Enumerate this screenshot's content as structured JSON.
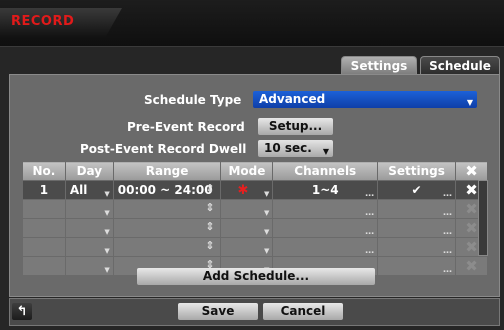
{
  "window": {
    "title": "RECORD"
  },
  "tabs": [
    {
      "label": "Settings"
    },
    {
      "label": "Schedule"
    }
  ],
  "schedule_type": {
    "label": "Schedule Type",
    "value": "Advanced"
  },
  "pre_event": {
    "label": "Pre-Event Record",
    "button": "Setup..."
  },
  "post_event": {
    "label": "Post-Event Record Dwell",
    "value": "10 sec."
  },
  "table": {
    "headers": [
      "No.",
      "Day",
      "Range",
      "Mode",
      "Channels",
      "Settings"
    ],
    "rows": [
      {
        "no": "1",
        "day": "All",
        "range": "00:00 ~ 24:00",
        "channels": "1~4",
        "settings": "✔"
      }
    ]
  },
  "add_schedule": "Add Schedule...",
  "footer": {
    "save": "Save",
    "cancel": "Cancel"
  },
  "colors": {
    "title_red": "#e11a1a",
    "dropdown_blue": "#1c61d8",
    "mode_red": "#e52020"
  }
}
